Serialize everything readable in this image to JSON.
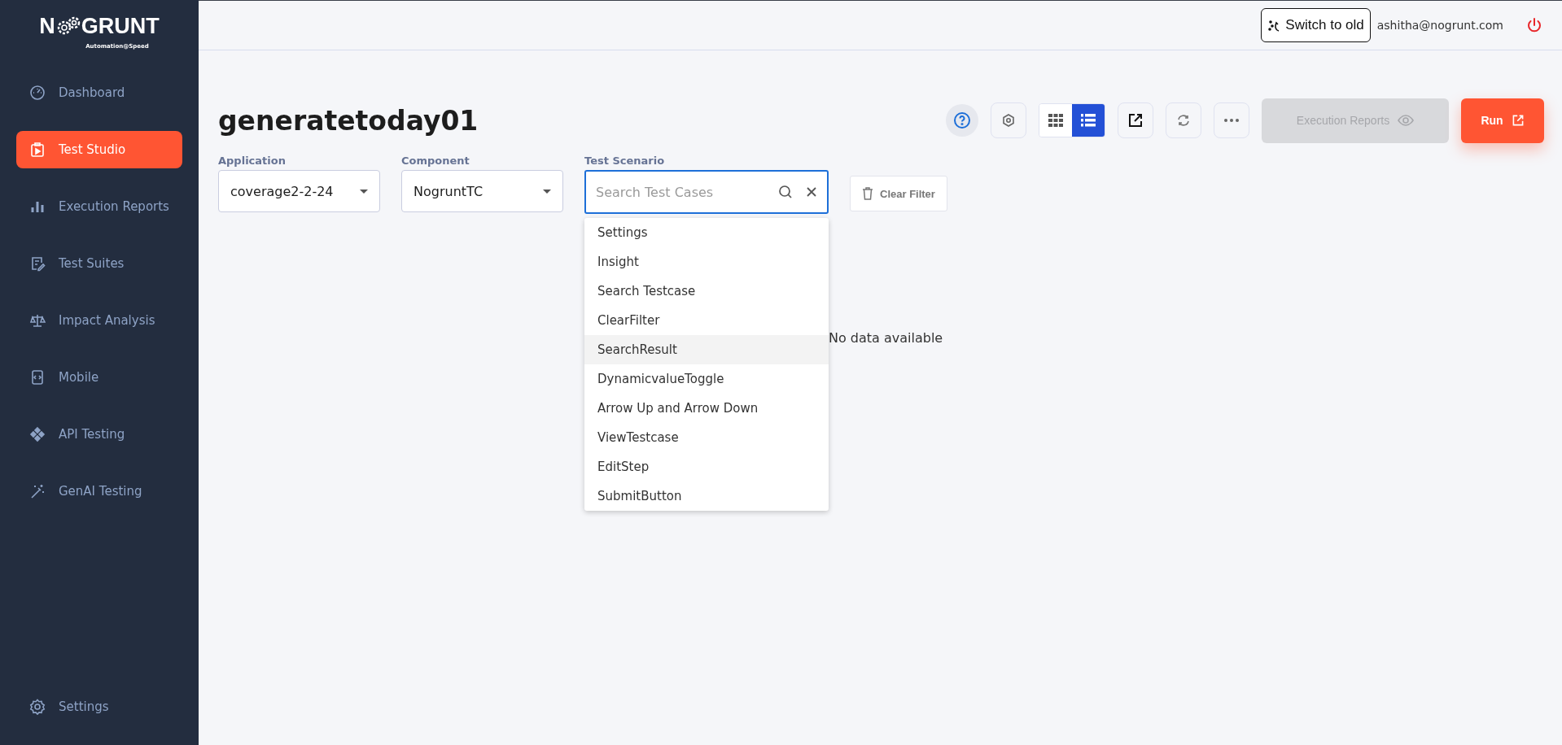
{
  "logo": {
    "prefix": "N",
    "suffix": "GRUNT",
    "tagline": "Automation@Speed"
  },
  "sidebar": {
    "items": [
      {
        "label": "Dashboard",
        "selected": false
      },
      {
        "label": "Test Studio",
        "selected": true
      },
      {
        "label": "Execution Reports",
        "selected": false
      },
      {
        "label": "Test Suites",
        "selected": false
      },
      {
        "label": "Impact Analysis",
        "selected": false
      },
      {
        "label": "Mobile",
        "selected": false
      },
      {
        "label": "API Testing",
        "selected": false
      },
      {
        "label": "GenAI Testing",
        "selected": false
      }
    ],
    "footer": {
      "label": "Settings",
      "selected": false
    }
  },
  "header": {
    "switch_button": "Switch to old",
    "user_email": "ashitha@nogrunt.com"
  },
  "page_title": "generatetoday01",
  "view_toggle": [
    {
      "kind": "grid",
      "selected": false
    },
    {
      "kind": "list",
      "selected": true
    }
  ],
  "execution_reports_button": {
    "label": "Execution Reports",
    "disabled": true
  },
  "run_button": "Run",
  "filters": {
    "application": {
      "label": "Application",
      "value": "coverage2-2-24"
    },
    "component": {
      "label": "Component",
      "value": "NogruntTC"
    },
    "test_scenario": {
      "label": "Test Scenario",
      "placeholder": "Search Test Cases"
    },
    "clear_filter": "Clear Filter"
  },
  "scenario_dropdown": [
    {
      "label": "Settings",
      "highlighted": false
    },
    {
      "label": "Insight",
      "highlighted": false
    },
    {
      "label": "Search Testcase",
      "highlighted": false
    },
    {
      "label": "ClearFilter",
      "highlighted": false
    },
    {
      "label": "SearchResult",
      "highlighted": true
    },
    {
      "label": "DynamicvalueToggle",
      "highlighted": false
    },
    {
      "label": "Arrow Up and Arrow Down",
      "highlighted": false
    },
    {
      "label": "ViewTestcase",
      "highlighted": false
    },
    {
      "label": "EditStep",
      "highlighted": false
    },
    {
      "label": "SubmitButton",
      "highlighted": false
    }
  ],
  "empty_message": "No data available"
}
